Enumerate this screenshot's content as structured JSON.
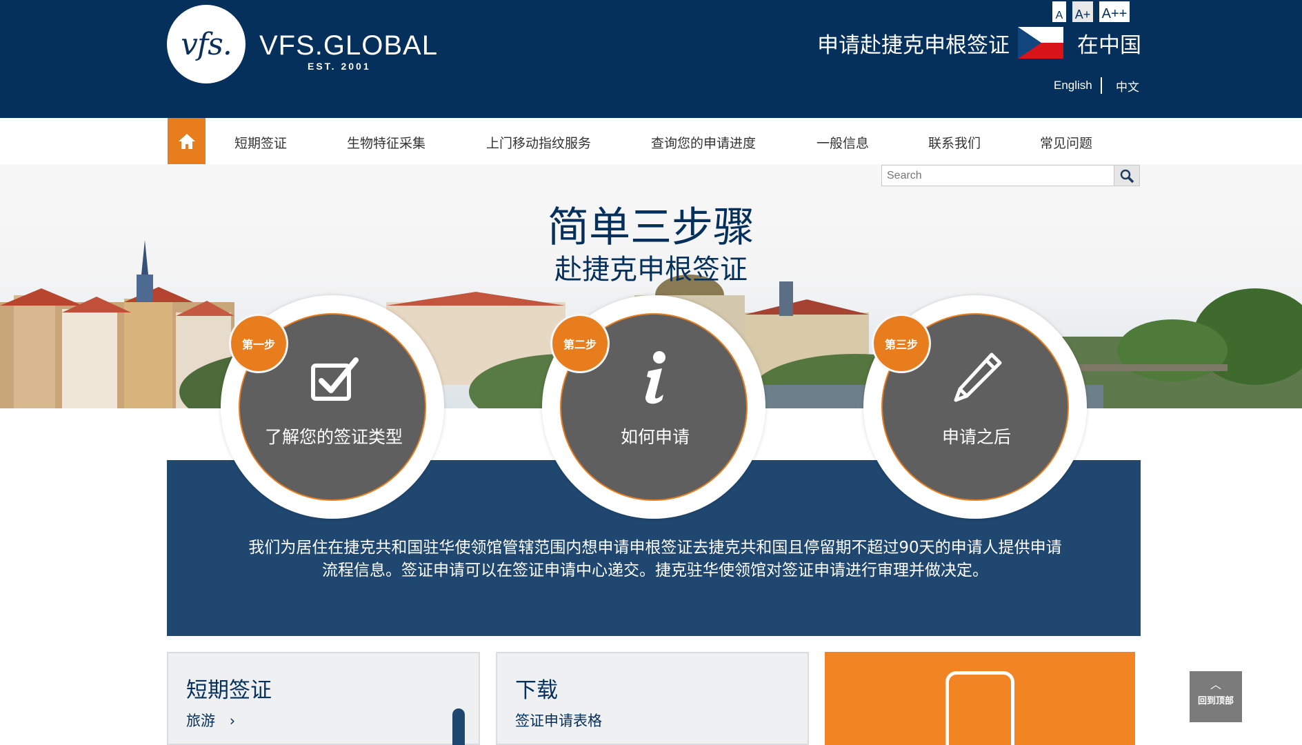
{
  "header": {
    "logo_mark": "vfs.",
    "logo_text": "VFS.GLOBAL",
    "logo_est": "EST. 2001",
    "title": "申请赴捷克申根签证",
    "country": "在中国",
    "font_sizes": [
      "A",
      "A+",
      "A++"
    ],
    "lang_english": "English",
    "lang_chinese": "中文",
    "colors": {
      "navy": "#05305b",
      "orange": "#e87d1e"
    }
  },
  "nav": {
    "home_icon": "home-icon",
    "items": [
      "短期签证",
      "生物特征采集",
      "上门移动指纹服务",
      "查询您的申请进度",
      "一般信息",
      "联系我们",
      "常见问题"
    ]
  },
  "search": {
    "placeholder": "Search",
    "icon": "search-icon"
  },
  "hero": {
    "title": "简单三步骤",
    "subtitle": "赴捷克申根签证"
  },
  "steps": [
    {
      "badge": "第一步",
      "label": "了解您的签证类型",
      "icon": "checkbox-icon"
    },
    {
      "badge": "第二步",
      "label": "如何申请",
      "icon": "info-icon"
    },
    {
      "badge": "第三步",
      "label": "申请之后",
      "icon": "pencil-icon"
    }
  ],
  "intro": {
    "text": "我们为居住在捷克共和国驻华使领馆管辖范围内想申请申根签证去捷克共和国且停留期不超过90天的申请人提供申请流程信息。签证申请可以在签证申请中心递交。捷克驻华使领馆对签证申请进行审理并做决定。"
  },
  "cards": [
    {
      "title": "短期签证",
      "link": "旅游"
    },
    {
      "title": "下载",
      "link": "签证申请表格"
    }
  ],
  "back_to_top": "回到顶部"
}
